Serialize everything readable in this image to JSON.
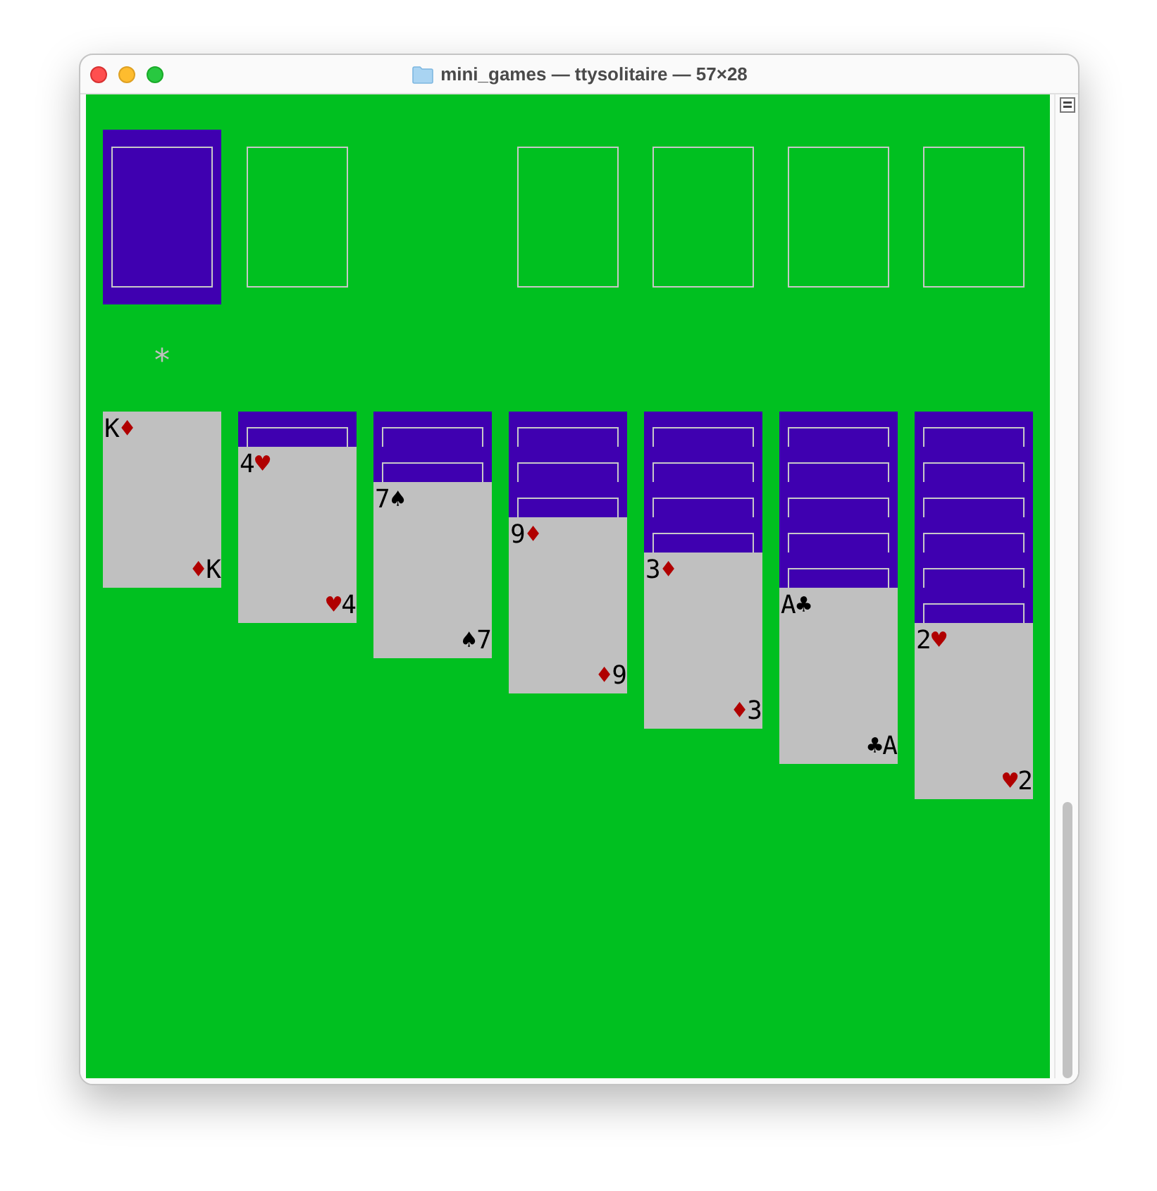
{
  "window": {
    "title": "mini_games — ttysolitaire — 57×28"
  },
  "slots": [
    {
      "kind": "deck"
    },
    {
      "kind": "outline"
    },
    {
      "kind": "blank"
    },
    {
      "kind": "outline"
    },
    {
      "kind": "outline"
    },
    {
      "kind": "outline"
    },
    {
      "kind": "outline"
    }
  ],
  "cursor": "*",
  "tableau": [
    {
      "cards": [
        {
          "face_up": true,
          "color": "#b00000",
          "top": {
            "rank": "K",
            "suit": "♦"
          },
          "bottom": {
            "suit": "♦",
            "rank": "K"
          }
        }
      ]
    },
    {
      "cards": [
        {
          "face_up": false
        },
        {
          "face_up": true,
          "color": "#b00000",
          "top": {
            "rank": "4",
            "suit": "♥"
          },
          "bottom": {
            "suit": "♥",
            "rank": "4"
          }
        }
      ]
    },
    {
      "cards": [
        {
          "face_up": false
        },
        {
          "face_up": false
        },
        {
          "face_up": true,
          "color": "#000000",
          "top": {
            "rank": "7",
            "suit": "♠"
          },
          "bottom": {
            "suit": "♠",
            "rank": "7"
          }
        }
      ]
    },
    {
      "cards": [
        {
          "face_up": false
        },
        {
          "face_up": false
        },
        {
          "face_up": false
        },
        {
          "face_up": true,
          "color": "#b00000",
          "top": {
            "rank": "9",
            "suit": "♦"
          },
          "bottom": {
            "suit": "♦",
            "rank": "9"
          }
        }
      ]
    },
    {
      "cards": [
        {
          "face_up": false
        },
        {
          "face_up": false
        },
        {
          "face_up": false
        },
        {
          "face_up": false
        },
        {
          "face_up": true,
          "color": "#b00000",
          "top": {
            "rank": "3",
            "suit": "♦"
          },
          "bottom": {
            "suit": "♦",
            "rank": "3"
          }
        }
      ]
    },
    {
      "cards": [
        {
          "face_up": false
        },
        {
          "face_up": false
        },
        {
          "face_up": false
        },
        {
          "face_up": false
        },
        {
          "face_up": false
        },
        {
          "face_up": true,
          "color": "#000000",
          "top": {
            "rank": "A",
            "suit": "♣"
          },
          "bottom": {
            "suit": "♣",
            "rank": "A"
          }
        }
      ]
    },
    {
      "cards": [
        {
          "face_up": false
        },
        {
          "face_up": false
        },
        {
          "face_up": false
        },
        {
          "face_up": false
        },
        {
          "face_up": false
        },
        {
          "face_up": false
        },
        {
          "face_up": true,
          "color": "#b00000",
          "top": {
            "rank": "2",
            "suit": "♥"
          },
          "bottom": {
            "suit": "♥",
            "rank": "2"
          }
        }
      ]
    }
  ]
}
